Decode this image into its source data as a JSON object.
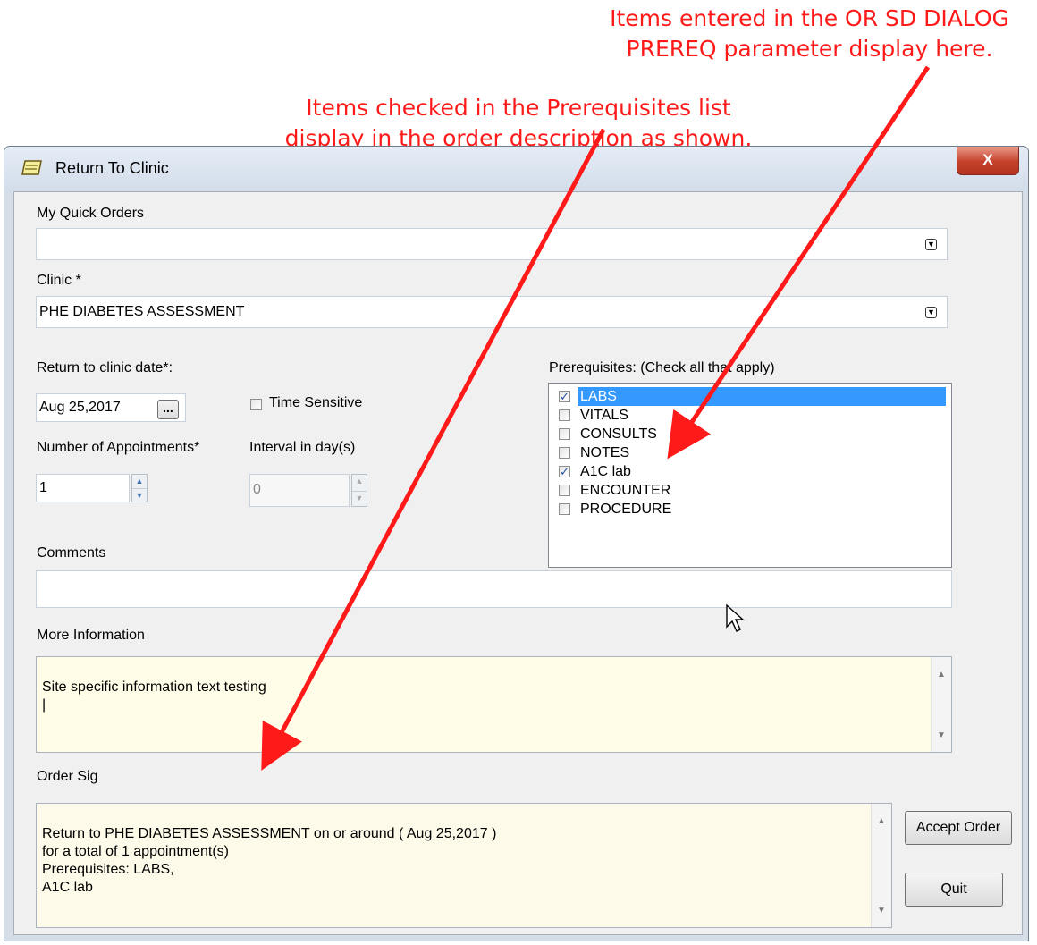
{
  "annotations": {
    "top_right": "Items entered in the OR SD DIALOG\nPREREQ parameter display here.",
    "middle": "Items checked in the Prerequisites list\ndisplay in the order description as shown."
  },
  "window": {
    "title": "Return To Clinic",
    "close_glyph": "X"
  },
  "quick_orders": {
    "label": "My Quick Orders",
    "value": ""
  },
  "clinic": {
    "label": "Clinic *",
    "value": "PHE DIABETES ASSESSMENT"
  },
  "return_date": {
    "label": "Return to clinic date*:",
    "value": "Aug 25,2017",
    "button": "..."
  },
  "time_sensitive": {
    "label": "Time Sensitive",
    "checked": false
  },
  "appointments": {
    "label": "Number of Appointments*",
    "value": "1"
  },
  "interval": {
    "label": "Interval in day(s)",
    "value": "0"
  },
  "prerequisites": {
    "label": "Prerequisites: (Check all that apply)",
    "items": [
      {
        "label": "LABS",
        "checked": true,
        "selected": true
      },
      {
        "label": "VITALS",
        "checked": false
      },
      {
        "label": "CONSULTS",
        "checked": false
      },
      {
        "label": "NOTES",
        "checked": false
      },
      {
        "label": "A1C lab",
        "checked": true
      },
      {
        "label": "ENCOUNTER",
        "checked": false
      },
      {
        "label": "PROCEDURE",
        "checked": false
      }
    ]
  },
  "comments": {
    "label": "Comments",
    "value": ""
  },
  "more_info": {
    "label": "More Information",
    "text": "Site specific information text testing\n|"
  },
  "order_sig": {
    "label": "Order Sig",
    "text": "Return to PHE DIABETES ASSESSMENT on or around ( Aug 25,2017 )\nfor a total of  1 appointment(s)\nPrerequisites: LABS,\nA1C lab"
  },
  "buttons": {
    "accept": "Accept Order",
    "quit": "Quit"
  },
  "colors": {
    "annotation": "#ff1a1a",
    "info_background": "#fffde8",
    "selection": "#3399ff"
  }
}
